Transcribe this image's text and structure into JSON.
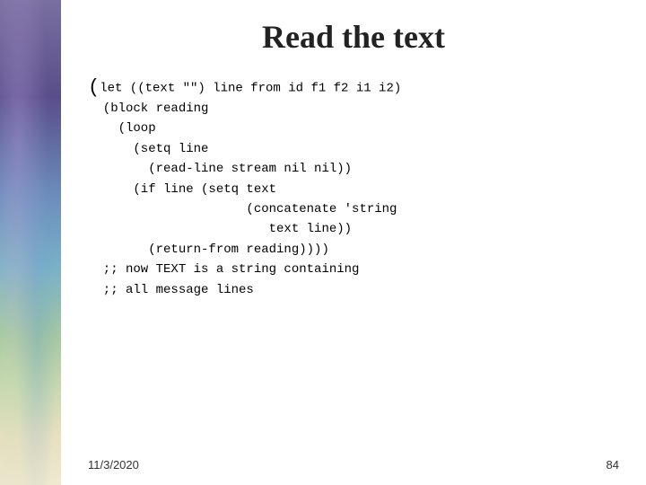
{
  "sidebar": {
    "label": "decorative sidebar"
  },
  "slide": {
    "title": "Read the text",
    "code": {
      "lines": [
        "(let ((text \"\") line from id f1 f2 i1 i2)",
        "  (block reading",
        "    (loop",
        "      (setq line",
        "        (read-line stream nil nil))",
        "      (if line (setq text",
        "                     (concatenate 'string",
        "                        text line))",
        "        (return-from reading))))",
        "  ;; now TEXT is a string containing",
        "  ;; all message lines"
      ]
    },
    "footer": {
      "date": "11/3/2020",
      "page": "84"
    }
  }
}
